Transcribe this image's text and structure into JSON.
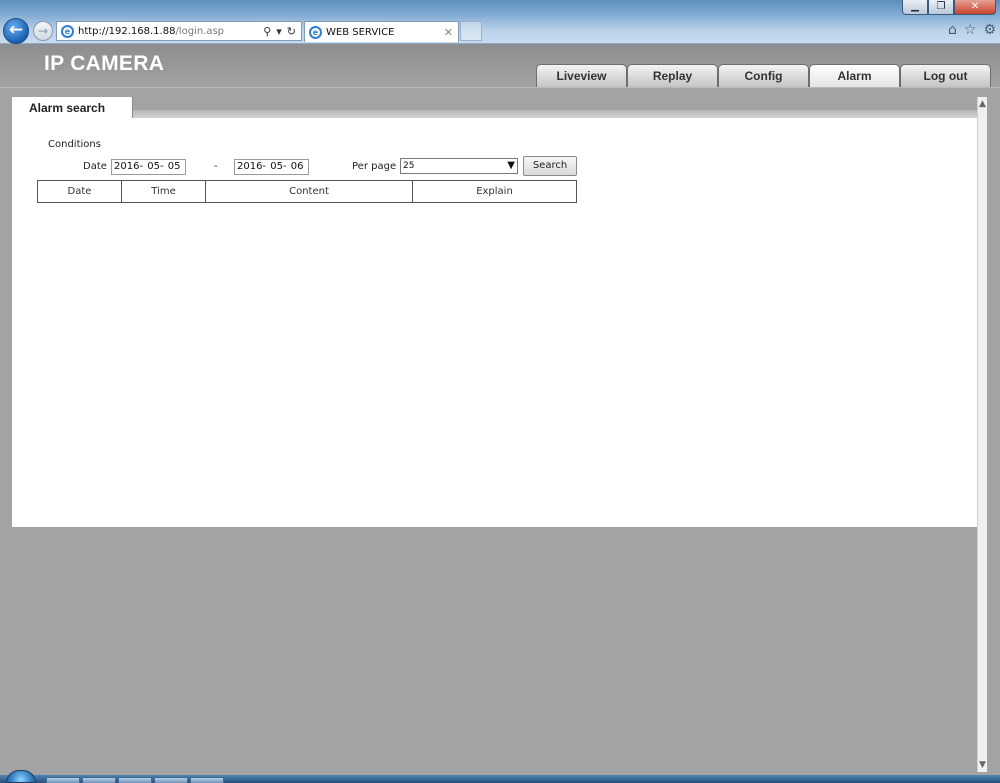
{
  "browser": {
    "url_host": "http://192.168.1.88",
    "url_path": "/login.asp",
    "tab_title": "WEB SERVICE",
    "icons": {
      "back": "arrow-left-icon",
      "forward": "arrow-right-icon",
      "search": "magnifier-icon",
      "refresh": "refresh-icon",
      "home": "home-icon",
      "favorites": "star-icon",
      "tools": "gear-icon"
    }
  },
  "app": {
    "brand": "IP CAMERA",
    "nav": [
      {
        "label": "Liveview"
      },
      {
        "label": "Replay"
      },
      {
        "label": "Config"
      },
      {
        "label": "Alarm"
      },
      {
        "label": "Log out"
      }
    ],
    "active_nav": "Alarm",
    "colors": {
      "header_bg": "#9a9a9c",
      "panel_bg": "#ffffff",
      "page_bg": "#a3a3a5"
    }
  },
  "alarm_search": {
    "subtab_label": "Alarm search",
    "conditions_label": "Conditions",
    "date_label": "Date",
    "date_from": "2016- 05- 05",
    "date_separator": "-",
    "date_to": "2016- 05- 06",
    "per_page_label": "Per page",
    "per_page_value": "25",
    "search_label": "Search",
    "columns": [
      "Date",
      "Time",
      "Content",
      "Explain"
    ]
  }
}
